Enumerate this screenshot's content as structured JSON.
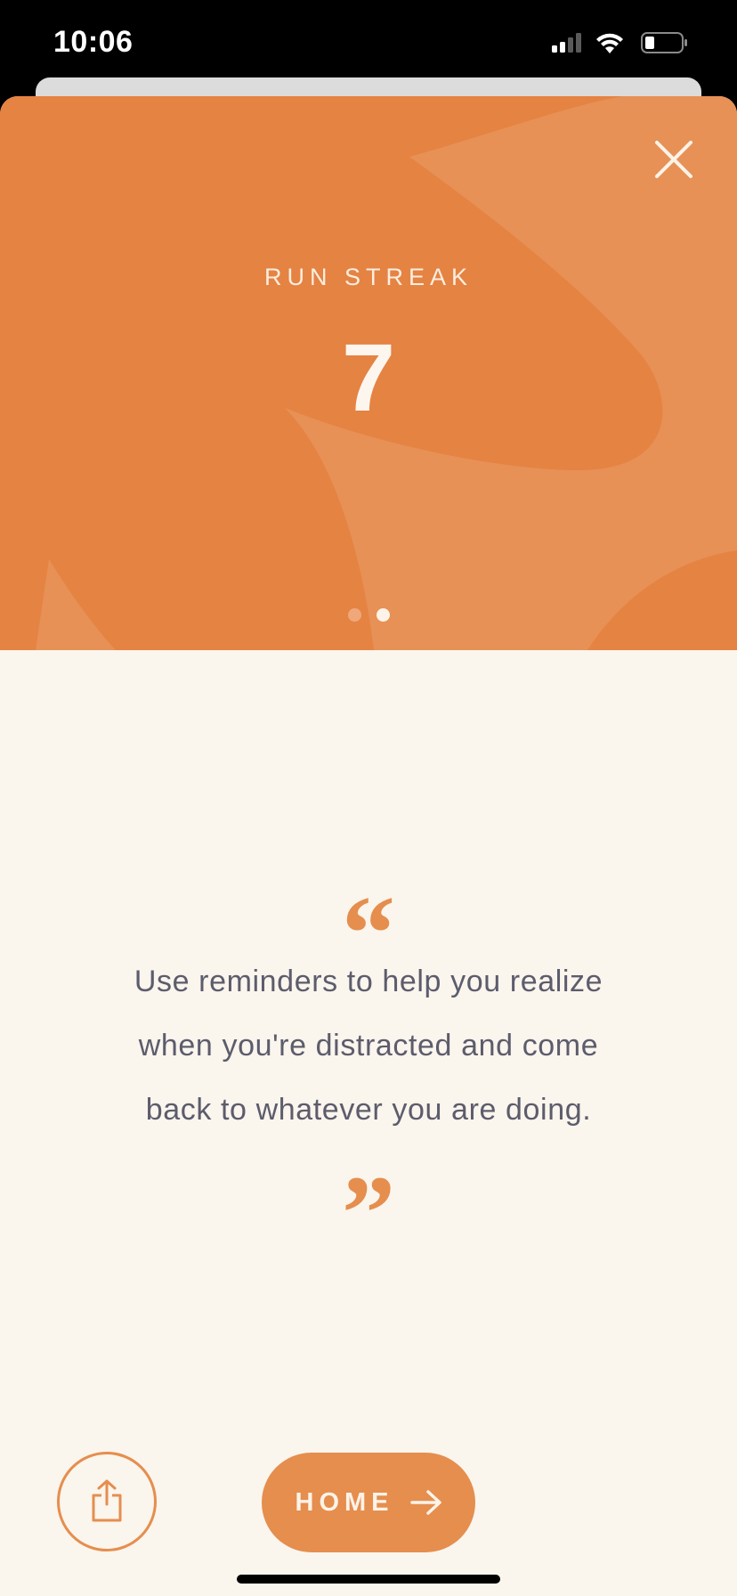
{
  "status_bar": {
    "time": "10:06"
  },
  "hero": {
    "label": "RUN STREAK",
    "value": "7",
    "pagination": {
      "total": 2,
      "active": 2
    }
  },
  "quote": {
    "open_mark": "“",
    "text": "Use reminders to help you realize when you're distracted and come back to whatever you are doing.",
    "close_mark": "”"
  },
  "actions": {
    "home_label": "HOME"
  },
  "colors": {
    "hero_bg": "#e58343",
    "accent": "#e58e4e",
    "page_bg": "#faf5ed",
    "text": "#5d5c6c"
  },
  "icons": {
    "close": "close-icon",
    "share": "share-icon",
    "arrow": "arrow-right-icon"
  }
}
